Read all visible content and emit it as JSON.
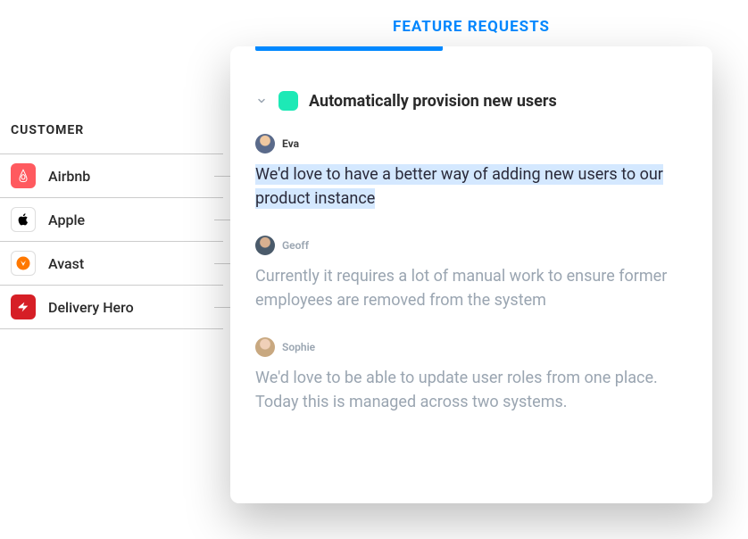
{
  "sidebar": {
    "header": "CUSTOMER",
    "items": [
      {
        "label": "Airbnb"
      },
      {
        "label": "Apple"
      },
      {
        "label": "Avast"
      },
      {
        "label": "Delivery Hero"
      }
    ]
  },
  "panel": {
    "heading": "FEATURE REQUESTS",
    "title": "Automatically provision new users",
    "comments": [
      {
        "author": "Eva",
        "body": "We'd love to have a better way of adding new users to our product instance",
        "highlighted": true
      },
      {
        "author": "Geoff",
        "body": "Currently it requires a lot of manual work to ensure former employees are removed from the system"
      },
      {
        "author": "Sophie",
        "body": "We'd love to be able to update user roles from one place. Today this is managed across two systems."
      }
    ]
  }
}
